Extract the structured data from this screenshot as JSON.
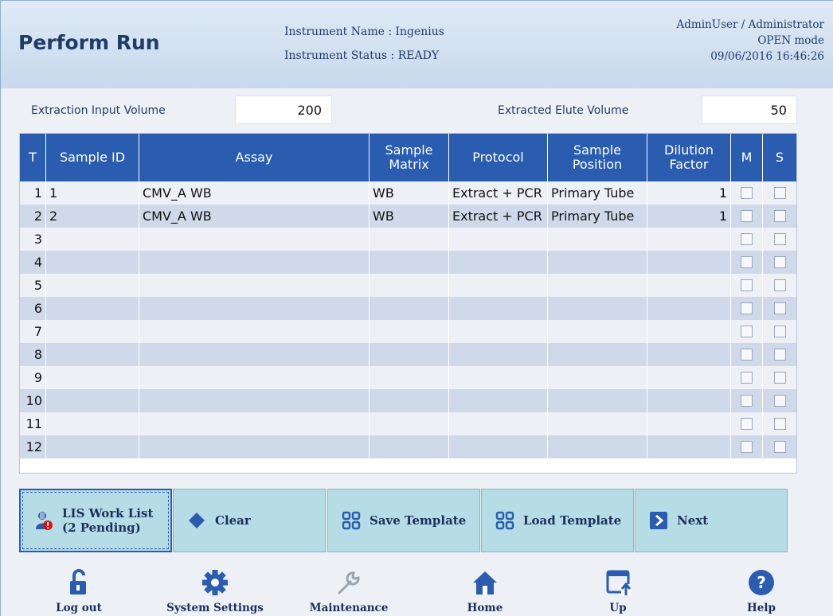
{
  "header": {
    "title": "Perform Run",
    "instrument_name": "Instrument Name : Ingenius",
    "instrument_status": "Instrument Status : READY",
    "user": "AdminUser / Administrator",
    "mode": "OPEN mode",
    "datetime": "09/06/2016 16:46:26"
  },
  "fields": {
    "extraction_input_label": "Extraction Input Volume",
    "extraction_input_value": "200",
    "extracted_elute_label": "Extracted Elute Volume",
    "extracted_elute_value": "50"
  },
  "table": {
    "headers": [
      "T",
      "Sample ID",
      "Assay",
      "Sample Matrix",
      "Protocol",
      "Sample Position",
      "Dilution Factor",
      "M",
      "S"
    ],
    "rows": [
      {
        "t": "1",
        "sample_id": "1",
        "assay": "CMV_A WB",
        "matrix": "WB",
        "protocol": "Extract + PCR",
        "position": "Primary Tube",
        "dilution": "1"
      },
      {
        "t": "2",
        "sample_id": "2",
        "assay": "CMV_A WB",
        "matrix": "WB",
        "protocol": "Extract + PCR",
        "position": "Primary Tube",
        "dilution": "1"
      },
      {
        "t": "3",
        "sample_id": "",
        "assay": "",
        "matrix": "",
        "protocol": "",
        "position": "",
        "dilution": ""
      },
      {
        "t": "4",
        "sample_id": "",
        "assay": "",
        "matrix": "",
        "protocol": "",
        "position": "",
        "dilution": ""
      },
      {
        "t": "5",
        "sample_id": "",
        "assay": "",
        "matrix": "",
        "protocol": "",
        "position": "",
        "dilution": ""
      },
      {
        "t": "6",
        "sample_id": "",
        "assay": "",
        "matrix": "",
        "protocol": "",
        "position": "",
        "dilution": ""
      },
      {
        "t": "7",
        "sample_id": "",
        "assay": "",
        "matrix": "",
        "protocol": "",
        "position": "",
        "dilution": ""
      },
      {
        "t": "8",
        "sample_id": "",
        "assay": "",
        "matrix": "",
        "protocol": "",
        "position": "",
        "dilution": ""
      },
      {
        "t": "9",
        "sample_id": "",
        "assay": "",
        "matrix": "",
        "protocol": "",
        "position": "",
        "dilution": ""
      },
      {
        "t": "10",
        "sample_id": "",
        "assay": "",
        "matrix": "",
        "protocol": "",
        "position": "",
        "dilution": ""
      },
      {
        "t": "11",
        "sample_id": "",
        "assay": "",
        "matrix": "",
        "protocol": "",
        "position": "",
        "dilution": ""
      },
      {
        "t": "12",
        "sample_id": "",
        "assay": "",
        "matrix": "",
        "protocol": "",
        "position": "",
        "dilution": ""
      }
    ]
  },
  "actions": {
    "lis_line1": "LIS Work List",
    "lis_line2": "(2 Pending)",
    "clear": "Clear",
    "save_template": "Save Template",
    "load_template": "Load Template",
    "next": "Next"
  },
  "nav": {
    "logout": "Log out",
    "system_settings": "System Settings",
    "maintenance": "Maintenance",
    "home": "Home",
    "up": "Up",
    "help": "Help"
  },
  "colors": {
    "header_blue": "#2a5db0",
    "button_teal": "#b6dce6",
    "title_navy": "#1f3c66"
  }
}
